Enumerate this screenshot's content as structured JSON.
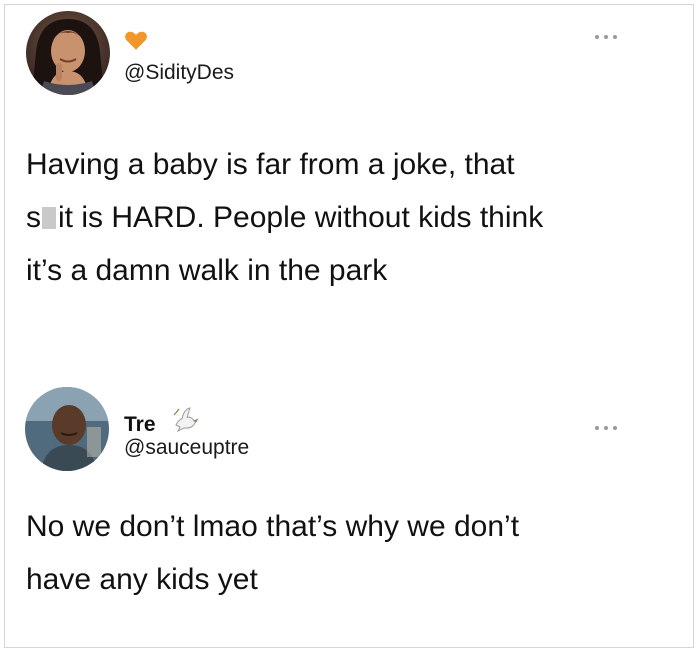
{
  "tweets": [
    {
      "avatar_icon": "avatar-woman-photo",
      "badge_icon": "orange-heart-icon",
      "badge_color": "#f0962a",
      "handle": "@SidityDes",
      "text_lines": [
        "Having a baby is far from a joke, that",
        {
          "before": "s",
          "after": "it is HARD. People without kids think"
        },
        "it’s a damn walk in the park"
      ],
      "more_icon": "more-dots-icon"
    },
    {
      "avatar_icon": "avatar-man-photo",
      "display_name": "Tre",
      "badge_icon": "dove-icon",
      "handle": "@sauceuptre",
      "text_lines": [
        "No we don’t lmao that’s why we don’t",
        "have any kids yet"
      ],
      "more_icon": "more-dots-icon"
    }
  ]
}
